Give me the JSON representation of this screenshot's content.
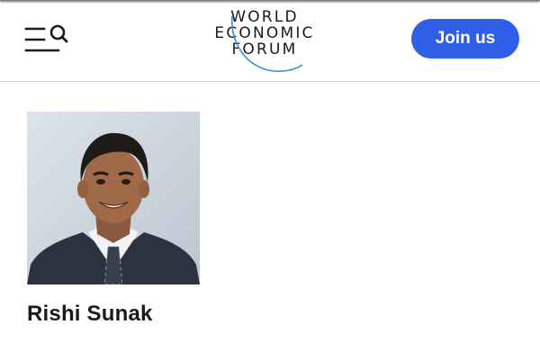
{
  "header": {
    "menu_icon": "menu-search-icon",
    "logo": {
      "line1": "WORLD",
      "line2": "ECONOMIC",
      "line3": "FORUM"
    },
    "join_label": "Join us"
  },
  "profile": {
    "name": "Rishi Sunak",
    "photo_icon": "portrait-photo"
  },
  "colors": {
    "accent": "#2f5fe6",
    "logo_arc": "#3a8fd8",
    "text": "#1a1a1a"
  }
}
